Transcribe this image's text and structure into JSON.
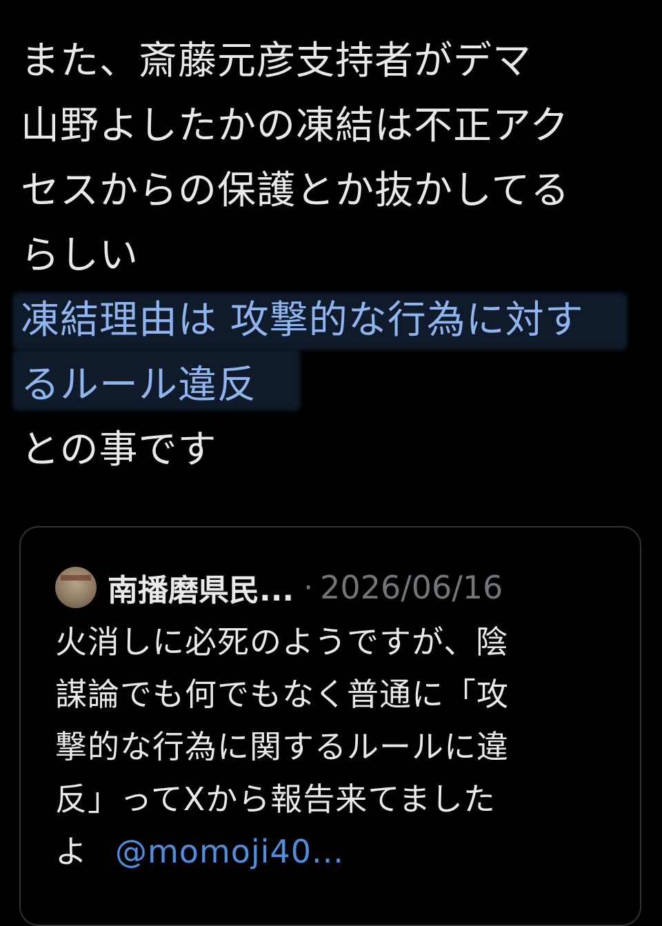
{
  "post": {
    "lines": [
      "また、斎藤元彦支持者がデマ",
      "山野よしたかの凍結は不正アク",
      "セスからの保護とか抜かしてる",
      "らしい"
    ],
    "highlighted_lines": [
      "凍結理由は 攻撃的な行為に対す",
      "るルール違反"
    ],
    "closing_line": "との事です"
  },
  "quote": {
    "author": "南播磨県民...",
    "separator": "·",
    "date": "2026/06/16",
    "lines": [
      "火消しに必死のようですが、陰",
      "謀論でも何でもなく普通に「攻",
      "撃的な行為に関するルールに違",
      "反」ってXから報告来てました"
    ],
    "last_line_prefix": "よ",
    "mention": "@momoji40..."
  },
  "colors": {
    "background": "#000000",
    "text": "#e7e9ea",
    "highlight_text": "#8fb4ee",
    "mention": "#4f8fe0",
    "muted": "#71767b",
    "border": "#2f3336"
  }
}
